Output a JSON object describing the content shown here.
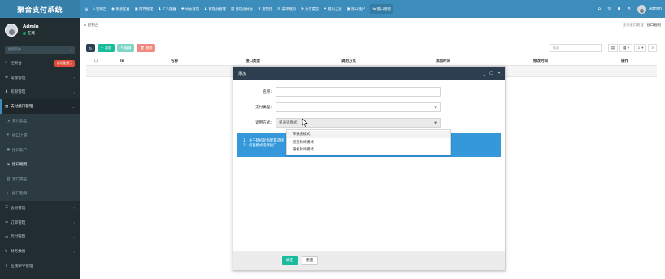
{
  "app": {
    "logo": "聚合支付系统"
  },
  "user": {
    "name": "Admin",
    "status": "在线"
  },
  "sidebar": {
    "search_placeholder": "搜索菜单",
    "items": [
      {
        "icon": "⌂",
        "label": "控制台",
        "badge": "新功能提示",
        "caret": ""
      },
      {
        "icon": "⚙",
        "label": "常规管理",
        "badge": "",
        "caret": "‹"
      },
      {
        "icon": "♜",
        "label": "权限管理",
        "badge": "",
        "caret": "‹"
      },
      {
        "icon": "▤",
        "label": "支付接口管理",
        "badge": "",
        "caret": "⌄"
      },
      {
        "icon": "◔",
        "label": "支付类型",
        "badge": "",
        "caret": ""
      },
      {
        "icon": "✦",
        "label": "接口上游",
        "badge": "",
        "caret": ""
      },
      {
        "icon": "▣",
        "label": "接口账户",
        "badge": "",
        "caret": ""
      },
      {
        "icon": "⇆",
        "label": "接口规则",
        "badge": "",
        "caret": ""
      },
      {
        "icon": "▥",
        "label": "银行类型",
        "badge": "",
        "caret": ""
      },
      {
        "icon": "⌕",
        "label": "接口检测",
        "badge": "",
        "caret": ""
      },
      {
        "icon": "☰",
        "label": "会员管理",
        "badge": "",
        "caret": "‹"
      },
      {
        "icon": "☷",
        "label": "订单管理",
        "badge": "",
        "caret": "‹"
      },
      {
        "icon": "▭",
        "label": "代付管理",
        "badge": "",
        "caret": "‹"
      },
      {
        "icon": "¥",
        "label": "财务数据",
        "badge": "",
        "caret": "‹"
      },
      {
        "icon": "↳",
        "label": "在线命令管理",
        "badge": "",
        "caret": ""
      }
    ]
  },
  "navbar": {
    "toggle": "≡",
    "links": [
      {
        "icon": "⌂",
        "label": "控制台"
      },
      {
        "icon": "◉",
        "label": "系统配置"
      },
      {
        "icon": "▣",
        "label": "附件管理"
      },
      {
        "icon": "♟",
        "label": "个人配置"
      },
      {
        "icon": "✚",
        "label": "日志管理"
      },
      {
        "icon": "♟",
        "label": "管理员管理"
      },
      {
        "icon": "▤",
        "label": "管理员日志"
      },
      {
        "icon": "♛",
        "label": "角色组"
      },
      {
        "icon": "☰",
        "label": "菜单规则"
      },
      {
        "icon": "◔",
        "label": "支付类型"
      },
      {
        "icon": "✦",
        "label": "接口上游"
      },
      {
        "icon": "▣",
        "label": "接口账户"
      },
      {
        "icon": "⇆",
        "label": "接口规则"
      }
    ],
    "right_icons": [
      "⌂",
      "↻",
      "▪",
      "✕"
    ],
    "admin": "Admin"
  },
  "breadcrumb": {
    "left": "控制台",
    "right_parent": "支付接口管理",
    "right_current": "接口规则"
  },
  "toolbar": {
    "refresh": "↻",
    "add": "+ 添加",
    "edit": "✎ 编辑",
    "delete": "🗑 删除",
    "search_placeholder": "搜索",
    "icons": [
      "▤",
      "▦ ▾",
      "⇩ ▾",
      "⌕"
    ]
  },
  "table": {
    "headers": [
      "☐",
      "Id",
      "名称",
      "接口类型",
      "调用方式",
      "添加时间",
      "修改时间",
      "操作"
    ]
  },
  "modal": {
    "title": "添加",
    "controls": [
      "_",
      "▢",
      "✕"
    ],
    "fields": [
      {
        "label": "名称:",
        "value": ""
      },
      {
        "label": "支付类型:",
        "value": ""
      },
      {
        "label": "调用方式:",
        "value": "单通道模式"
      }
    ],
    "dropdown_options": [
      "单通道模式",
      "权重轮询模式",
      "随机轮询模式"
    ],
    "tip_lines": [
      "1、关于随机轮询配置选择",
      "2、权重模式选择接口"
    ],
    "ok": "确定",
    "reset": "重置"
  }
}
